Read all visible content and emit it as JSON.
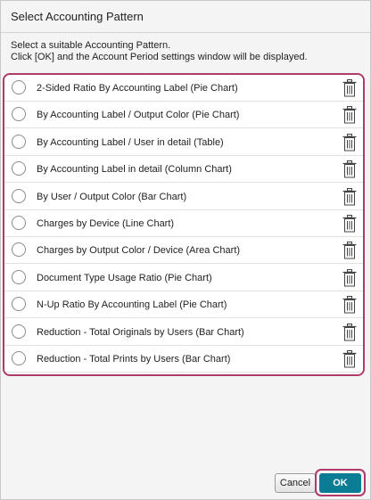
{
  "dialog": {
    "title": "Select Accounting Pattern",
    "instructions": [
      "Select a suitable Accounting Pattern.",
      "Click [OK] and the Account Period settings window will be displayed."
    ]
  },
  "patterns": [
    {
      "label": "2-Sided Ratio By Accounting Label (Pie Chart)",
      "selected": false
    },
    {
      "label": "By Accounting Label / Output Color (Pie Chart)",
      "selected": false
    },
    {
      "label": "By Accounting Label / User in detail (Table)",
      "selected": false
    },
    {
      "label": "By Accounting Label in detail (Column Chart)",
      "selected": false
    },
    {
      "label": "By User / Output Color (Bar Chart)",
      "selected": false
    },
    {
      "label": "Charges by Device (Line Chart)",
      "selected": false
    },
    {
      "label": "Charges by Output Color / Device (Area Chart)",
      "selected": false
    },
    {
      "label": "Document Type Usage Ratio (Pie Chart)",
      "selected": false
    },
    {
      "label": "N-Up Ratio By Accounting Label (Pie Chart)",
      "selected": false
    },
    {
      "label": "Reduction - Total Originals by Users (Bar Chart)",
      "selected": false
    },
    {
      "label": "Reduction - Total Prints by Users (Bar Chart)",
      "selected": false
    }
  ],
  "row_icons": {
    "select": "radio-button",
    "delete": "trash-icon"
  },
  "buttons": {
    "cancel_label": "Cancel",
    "ok_label": "OK"
  },
  "colors": {
    "ok_button": "#0a7c93",
    "highlight": "#b03a6a"
  }
}
